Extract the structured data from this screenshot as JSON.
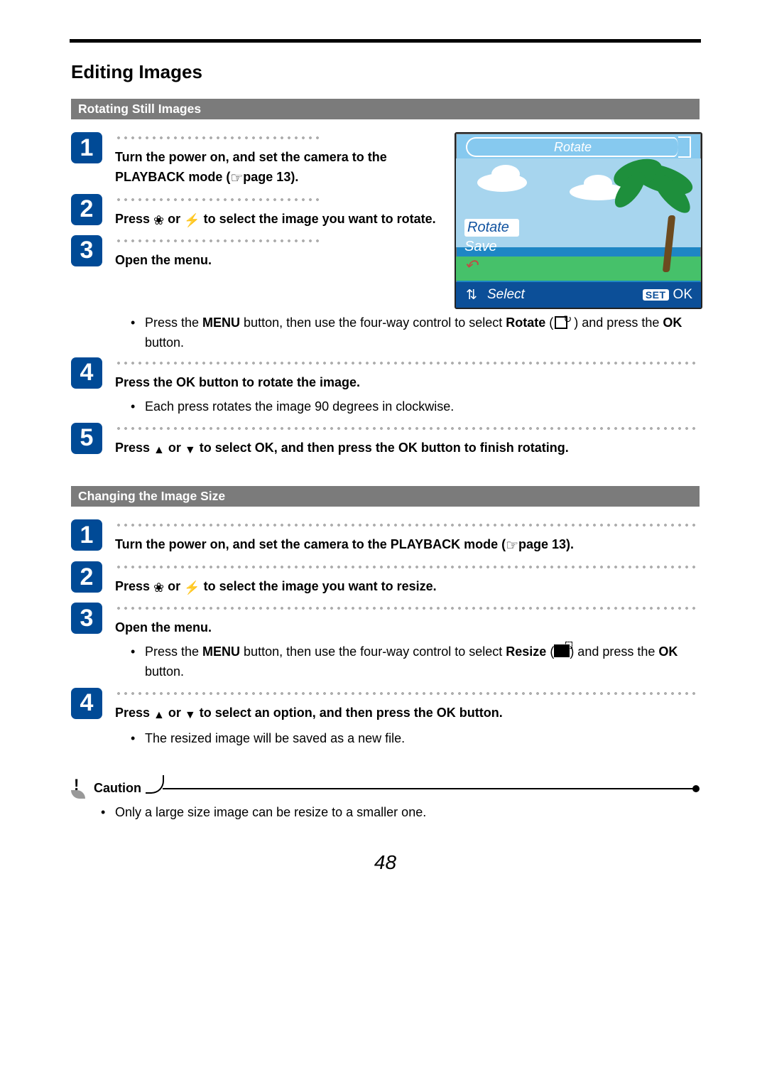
{
  "page": {
    "title": "Editing Images",
    "number": "48"
  },
  "sections": {
    "rotate": {
      "header": "Rotating Still Images",
      "steps": {
        "1": {
          "num": "1",
          "text_a": "Turn the power on, and set the camera to the PLAYBACK mode (",
          "text_b": "page 13)."
        },
        "2": {
          "num": "2",
          "text_a": "Press ",
          "text_b": " or ",
          "text_c": " to select the image you want to rotate."
        },
        "3": {
          "num": "3",
          "lead": "Open the menu.",
          "bullet_a": "Press the ",
          "bullet_b": "MENU",
          "bullet_c": " button, then use the four-way control to select ",
          "bullet_d": "Rotate",
          "bullet_e": " (",
          "bullet_f": " ) and press the ",
          "bullet_g": "OK",
          "bullet_h": " button."
        },
        "4": {
          "num": "4",
          "lead": "Press the OK button to rotate the image.",
          "bullet": "Each press rotates the image 90 degrees in clockwise."
        },
        "5": {
          "num": "5",
          "text_a": "Press ",
          "text_b": " or ",
          "text_c": " to select OK, and then press the OK button to finish rotating."
        }
      }
    },
    "resize": {
      "header": "Changing the Image Size",
      "steps": {
        "1": {
          "num": "1",
          "text_a": "Turn the power on, and set the camera to the PLAYBACK mode (",
          "text_b": "page 13)."
        },
        "2": {
          "num": "2",
          "text_a": "Press ",
          "text_b": " or ",
          "text_c": " to select the image you want to resize."
        },
        "3": {
          "num": "3",
          "lead": "Open the menu.",
          "bullet_a": "Press the ",
          "bullet_b": "MENU",
          "bullet_c": " button, then use the four-way control to select ",
          "bullet_d": "Resize",
          "bullet_e": " (",
          "bullet_f": ") and press the ",
          "bullet_g": "OK",
          "bullet_h": " button."
        },
        "4": {
          "num": "4",
          "lead_a": "Press ",
          "lead_b": " or ",
          "lead_c": " to select an option, and then press the OK button.",
          "bullet": "The resized image will be saved as a new file."
        }
      }
    }
  },
  "lcd": {
    "title": "Rotate",
    "menu1": "Rotate",
    "menu2": "Save",
    "menu3_icon": "undo-icon",
    "footer_select": "Select",
    "footer_set": "SET",
    "footer_ok": "OK"
  },
  "caution": {
    "label": "Caution",
    "bullet": "Only a large size image can be resize to a smaller one."
  },
  "icons": {
    "macro": "❀",
    "flash": "⚡",
    "hand": "☞",
    "up": "▲",
    "down": "▼",
    "undo": "↶",
    "updown": "⇅"
  }
}
